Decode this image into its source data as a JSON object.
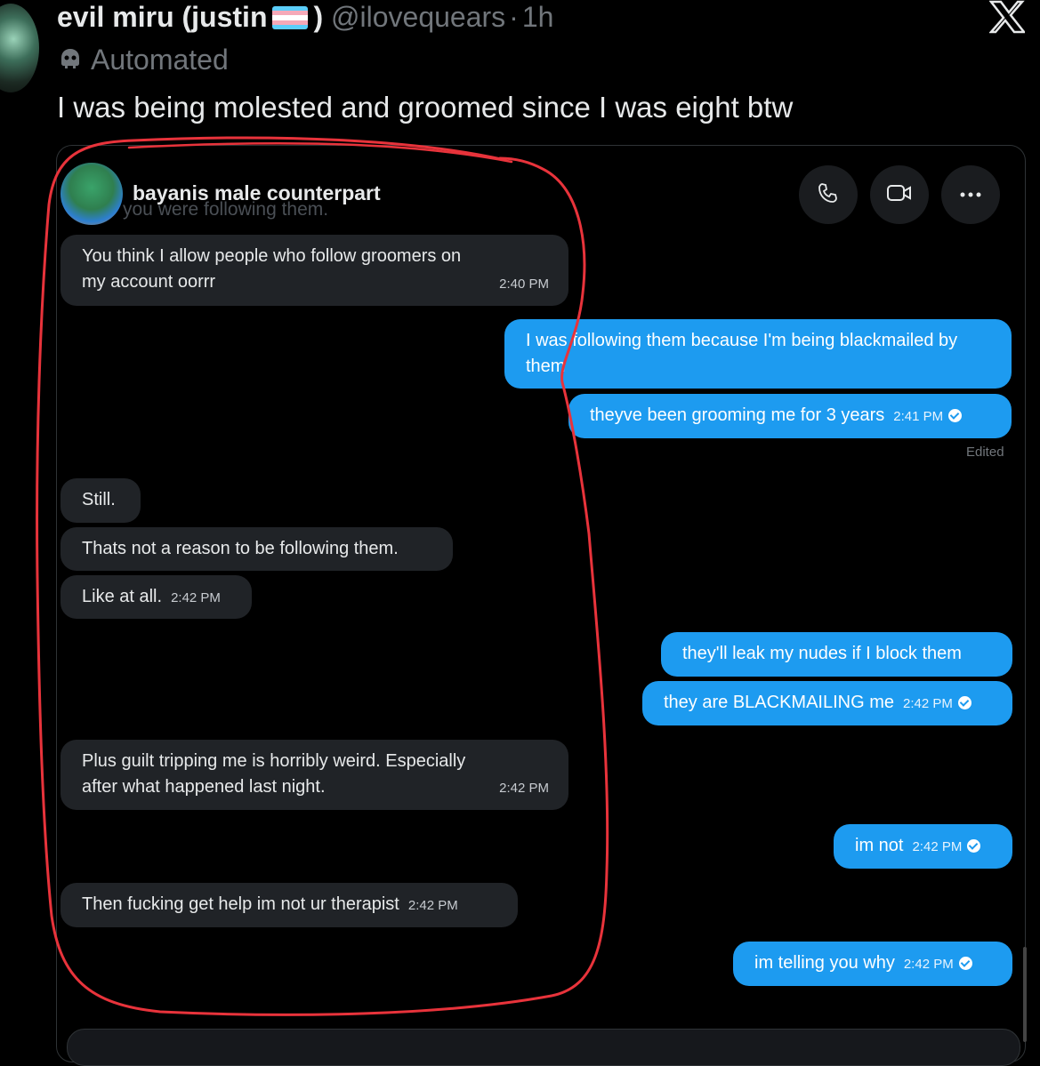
{
  "tweet": {
    "display_name": "evil miru (justin",
    "display_name_close": ")",
    "handle": "@ilovequears",
    "separator": "·",
    "time": "1h",
    "automated_label": "Automated",
    "text": "I was being molested and groomed since I was eight btw"
  },
  "dm": {
    "contact_name": "bayanis male counterpart",
    "ghost_text": "you were following them.",
    "edited_label": "Edited",
    "messages": [
      {
        "side": "in",
        "text": "You think I allow people who follow groomers on my account oorrr",
        "time": "2:40 PM"
      },
      {
        "side": "out",
        "text": "I was following them because I'm being blackmailed by them",
        "time": ""
      },
      {
        "side": "out",
        "text": "theyve been grooming me for 3 years",
        "time": "2:41 PM"
      },
      {
        "side": "in",
        "text": "Still.",
        "time": ""
      },
      {
        "side": "in",
        "text": "Thats not a reason to be following them.",
        "time": ""
      },
      {
        "side": "in",
        "text": "Like at all.",
        "time": "2:42 PM"
      },
      {
        "side": "out",
        "text": "they'll leak my nudes if I block them",
        "time": ""
      },
      {
        "side": "out",
        "text": "they are BLACKMAILING me",
        "time": "2:42 PM"
      },
      {
        "side": "in",
        "text": "Plus guilt tripping me is horribly weird. Especially after what happened last night.",
        "time": "2:42 PM"
      },
      {
        "side": "out",
        "text": "im not",
        "time": "2:42 PM"
      },
      {
        "side": "in",
        "text": "Then fucking get help im not ur therapist",
        "time": "2:42 PM"
      },
      {
        "side": "out",
        "text": "im telling you why",
        "time": "2:42 PM"
      }
    ]
  },
  "colors": {
    "background": "#000000",
    "incoming_bubble": "#202327",
    "outgoing_bubble": "#1d9bf0",
    "annotation_red": "#e8333b",
    "muted_text": "#71767b"
  },
  "icons": [
    "trans-flag-icon",
    "bot-icon",
    "x-logo-icon",
    "phone-icon",
    "video-icon",
    "more-icon",
    "check-icon"
  ]
}
